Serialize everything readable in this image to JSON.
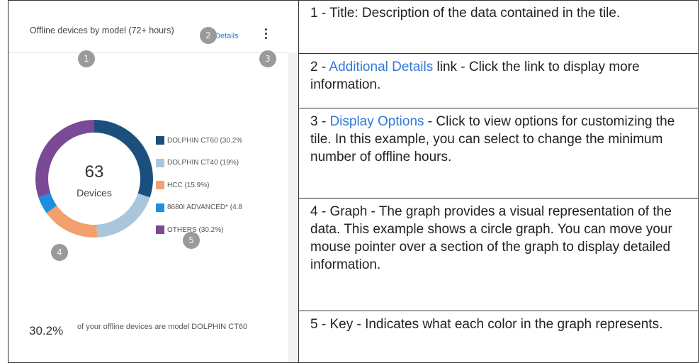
{
  "tile": {
    "title": "Offline devices by model (72+ hours)",
    "details_label": "Details",
    "callouts": [
      "1",
      "2",
      "3",
      "4",
      "5"
    ],
    "center_number": "63",
    "center_label": "Devices",
    "summary_percent": "30.2%",
    "summary_text": "of your offline devices are model DOLPHIN CT60",
    "colors": {
      "accent_link": "#2f79d8",
      "callout": "#9a9a9a"
    }
  },
  "chart_data": {
    "type": "pie",
    "donut": true,
    "center_text": "63 Devices",
    "categories": [
      "DOLPHIN CT60",
      "DOLPHIN CT40",
      "HCC",
      "8680I ADVANCED*",
      "OTHERS"
    ],
    "values": [
      30.2,
      19,
      15.9,
      4.8,
      30.2
    ],
    "legend_labels": [
      "DOLPHIN CT60 (30.2%",
      "DOLPHIN CT40 (19%)",
      "HCC (15.9%)",
      "8680I ADVANCED* (4.8",
      "OTHERS (30.2%)"
    ],
    "colors": [
      "#1b4f7d",
      "#a9c6dd",
      "#f2a06e",
      "#1e8fe0",
      "#7a4a96"
    ],
    "legend_position": "right"
  },
  "descriptions": [
    {
      "pre": "1 - Title: Description of the data contained in the tile.",
      "link": "",
      "post": ""
    },
    {
      "pre": "2 - ",
      "link": "Additional Details",
      "post": " link - Click the link to display more information."
    },
    {
      "pre": "3 - ",
      "link": "Display Options",
      "post": " - Click to view options for customizing the tile. In this example, you can select to change the minimum number of offline hours."
    },
    {
      "pre": "4 - Graph - The graph provides a visual representation of the data. This example shows a circle graph. You can move your mouse pointer over a section of the graph to display detailed information.",
      "link": "",
      "post": ""
    },
    {
      "pre": "5 - Key - Indicates what each color in the graph represents.",
      "link": "",
      "post": ""
    }
  ]
}
